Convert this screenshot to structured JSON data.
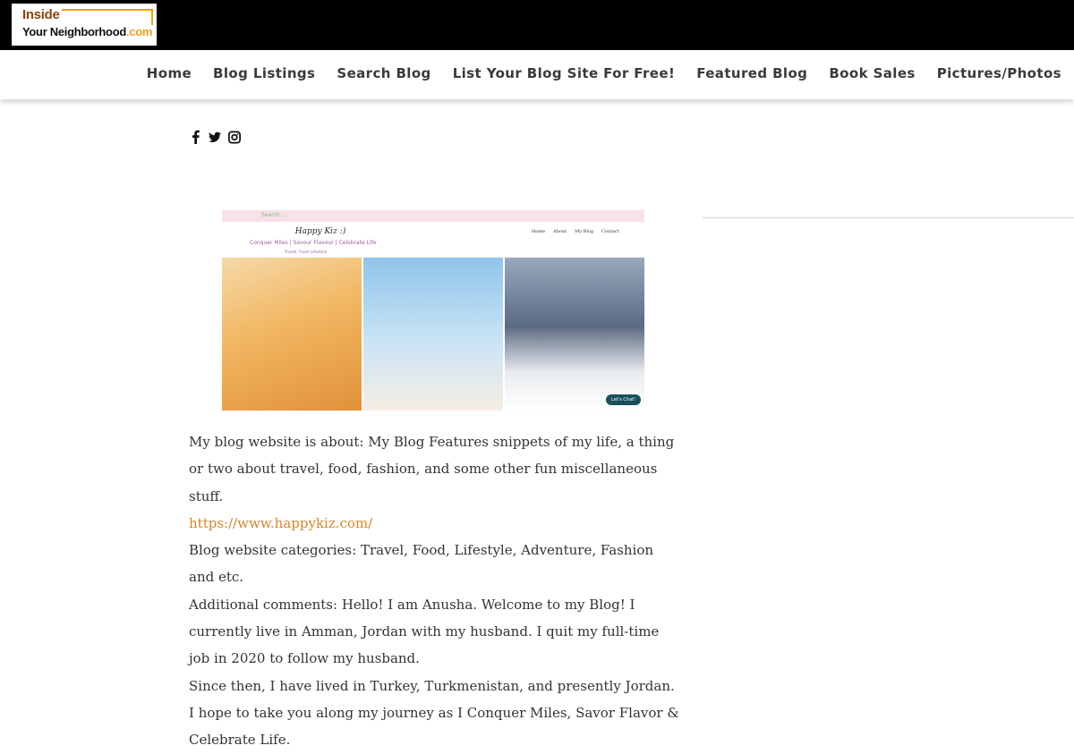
{
  "logo": {
    "line1": "Inside",
    "line2": "Your Neighborhood",
    "suffix": ".com"
  },
  "nav": [
    {
      "label": "Home"
    },
    {
      "label": "Blog Listings"
    },
    {
      "label": "Search Blog"
    },
    {
      "label": "List Your Blog Site For Free!"
    },
    {
      "label": "Featured Blog"
    },
    {
      "label": "Book Sales"
    },
    {
      "label": "Pictures/Photos"
    }
  ],
  "social_icons": [
    "facebook-icon",
    "twitter-icon",
    "instagram-icon"
  ],
  "blog_screenshot": {
    "search": "Search...",
    "title": "Happy Kiz :)",
    "tagline": "Conquer Miles | Savour Flavour | Celebrate Life",
    "categories": "Travel, Food Lifestyle",
    "menu": [
      "Home",
      "About",
      "My Blog",
      "Contact"
    ],
    "chat": "Let's Chat!"
  },
  "content": {
    "about": "My blog website is about: My Blog Features snippets of my life, a thing or two about travel, food, fashion, and some other fun miscellaneous stuff.",
    "url": "https://www.happykiz.com/",
    "categories": "Blog website categories: Travel, Food, Lifestyle, Adventure, Fashion and etc.",
    "comments": "Additional comments: Hello! I am Anusha. Welcome to my Blog! I currently live in Amman, Jordan with my husband. I quit my full-time job in 2020 to follow my husband.",
    "since": "Since then, I have lived in Turkey, Turkmenistan, and presently Jordan. I hope to take you along my journey as I Conquer Miles, Savor Flavor & Celebrate Life."
  }
}
